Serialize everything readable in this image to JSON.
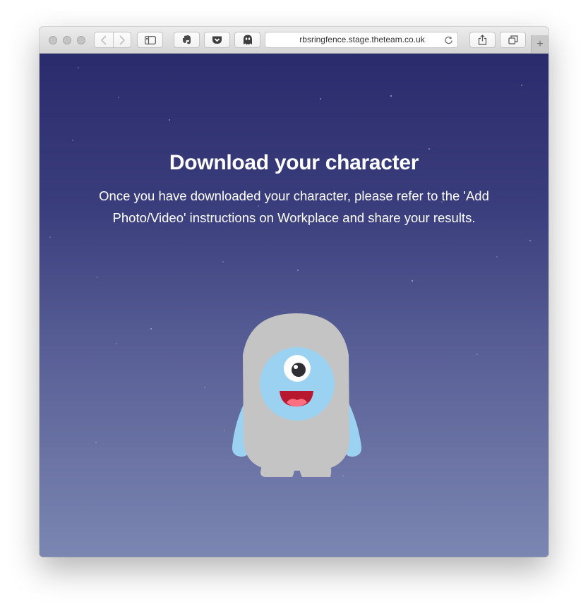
{
  "browser": {
    "url": "rbsringfence.stage.theteam.co.uk",
    "traffic_lights": [
      "close-button",
      "minimize-button",
      "zoom-button"
    ],
    "toolbar_icons": [
      "back-icon",
      "forward-icon",
      "sidebar-icon",
      "evernote-icon",
      "pocket-icon",
      "ghostery-icon",
      "reload-icon",
      "share-icon",
      "tabs-overview-icon",
      "new-tab-icon"
    ],
    "new_tab_symbol": "+"
  },
  "page": {
    "title": "Download your character",
    "description": "Once you have downloaded your character, please refer to the 'Add Photo/Video' instructions on Workplace and share your results."
  },
  "colors": {
    "background_top": "#2a2b6c",
    "background_bottom": "#7b86b1",
    "monster_body": "#c4c4c4",
    "monster_face": "#9bd2f2",
    "monster_mouth": "#b8182f"
  }
}
